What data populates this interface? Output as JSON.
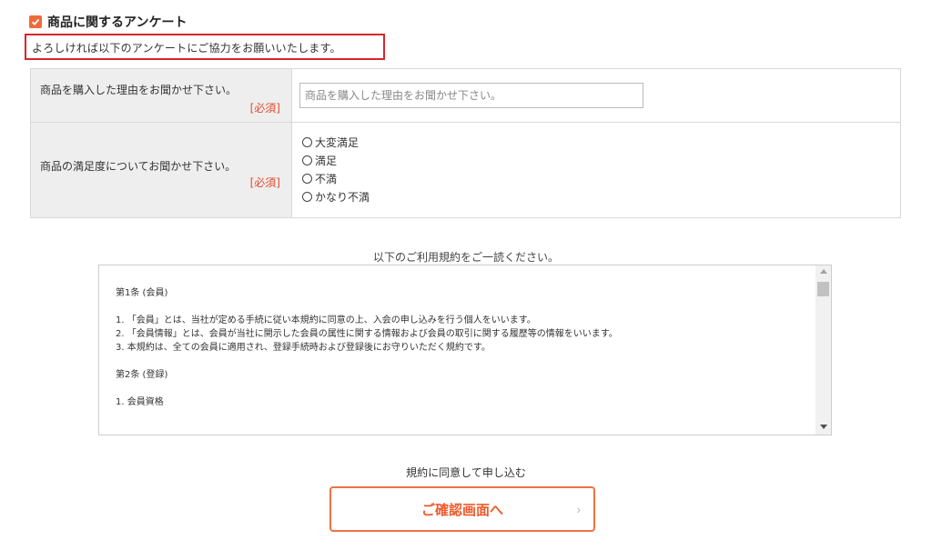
{
  "survey": {
    "title": "商品に関するアンケート",
    "note": "よろしければ以下のアンケートにご協力をお願いいたします。"
  },
  "form": {
    "rows": [
      {
        "label": "商品を購入した理由をお聞かせ下さい。",
        "required": "[必須]",
        "input_placeholder": "商品を購入した理由をお聞かせ下さい。"
      },
      {
        "label": "商品の満足度についてお聞かせ下さい。",
        "required": "[必須]",
        "options": [
          "大変満足",
          "満足",
          "不満",
          "かなり不満"
        ]
      }
    ]
  },
  "terms": {
    "heading": "以下のご利用規約をご一読ください。",
    "lines": [
      "第1条 (会員)",
      "1. 「会員」とは、当社が定める手続に従い本規約に同意の上、入会の申し込みを行う個人をいいます。",
      "2. 「会員情報」とは、会員が当社に開示した会員の属性に関する情報および会員の取引に関する履歴等の情報をいいます。",
      "3. 本規約は、全ての会員に適用され、登録手続時および登録後にお守りいただく規約です。",
      "第2条 (登録)",
      "1. 会員資格"
    ]
  },
  "submit": {
    "agree_text": "規約に同意して申し込む",
    "button_label": "ご確認画面へ",
    "chevron": "›"
  },
  "colors": {
    "accent": "#ee6a3a",
    "highlight_border": "#d9252b",
    "required": "#e24b2f"
  }
}
